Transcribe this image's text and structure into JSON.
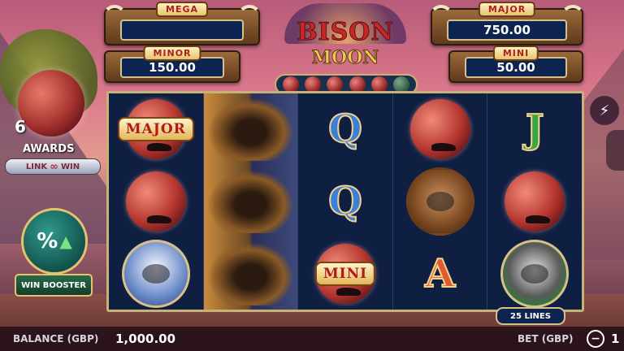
{
  "logo": {
    "line1": "BISON",
    "line2": "MOON"
  },
  "jackpots": {
    "mega": {
      "label": "MEGA",
      "value": ""
    },
    "minor": {
      "label": "MINOR",
      "value": "150.00"
    },
    "major": {
      "label": "MAJOR",
      "value": "750.00"
    },
    "mini": {
      "label": "MINI",
      "value": "50.00"
    }
  },
  "moon_tracker": {
    "lit": 5,
    "total": 6
  },
  "left_panel": {
    "award_count": "6",
    "awards_label": "AWARDS",
    "link_win_label": "LINK",
    "link_win_label2": "WIN",
    "booster_symbol": "%",
    "booster_label": "WIN BOOSTER"
  },
  "reels": [
    [
      {
        "symbol": "moon",
        "label": "MAJOR"
      },
      {
        "symbol": "moon",
        "label": ""
      },
      {
        "symbol": "eagle",
        "label": ""
      }
    ],
    [
      {
        "symbol": "bison",
        "label": ""
      },
      {
        "symbol": "bison",
        "label": ""
      },
      {
        "symbol": "bison",
        "label": ""
      }
    ],
    [
      {
        "symbol": "letter",
        "label": "Q",
        "style": "q"
      },
      {
        "symbol": "letter",
        "label": "Q",
        "style": "q"
      },
      {
        "symbol": "moon",
        "label": "MINI"
      }
    ],
    [
      {
        "symbol": "moon",
        "label": ""
      },
      {
        "symbol": "bear",
        "label": ""
      },
      {
        "symbol": "letter",
        "label": "A",
        "style": "a"
      }
    ],
    [
      {
        "symbol": "letter",
        "label": "J",
        "style": "j"
      },
      {
        "symbol": "moon",
        "label": ""
      },
      {
        "symbol": "raccoon",
        "label": ""
      }
    ]
  ],
  "lines_label": "25 LINES",
  "bottom_bar": {
    "balance_label": "BALANCE (GBP)",
    "balance_value": "1,000.00",
    "bet_label": "BET (GBP)",
    "minus": "−",
    "bet_value": "1"
  },
  "icons": {
    "turbo": "lightning-icon"
  }
}
